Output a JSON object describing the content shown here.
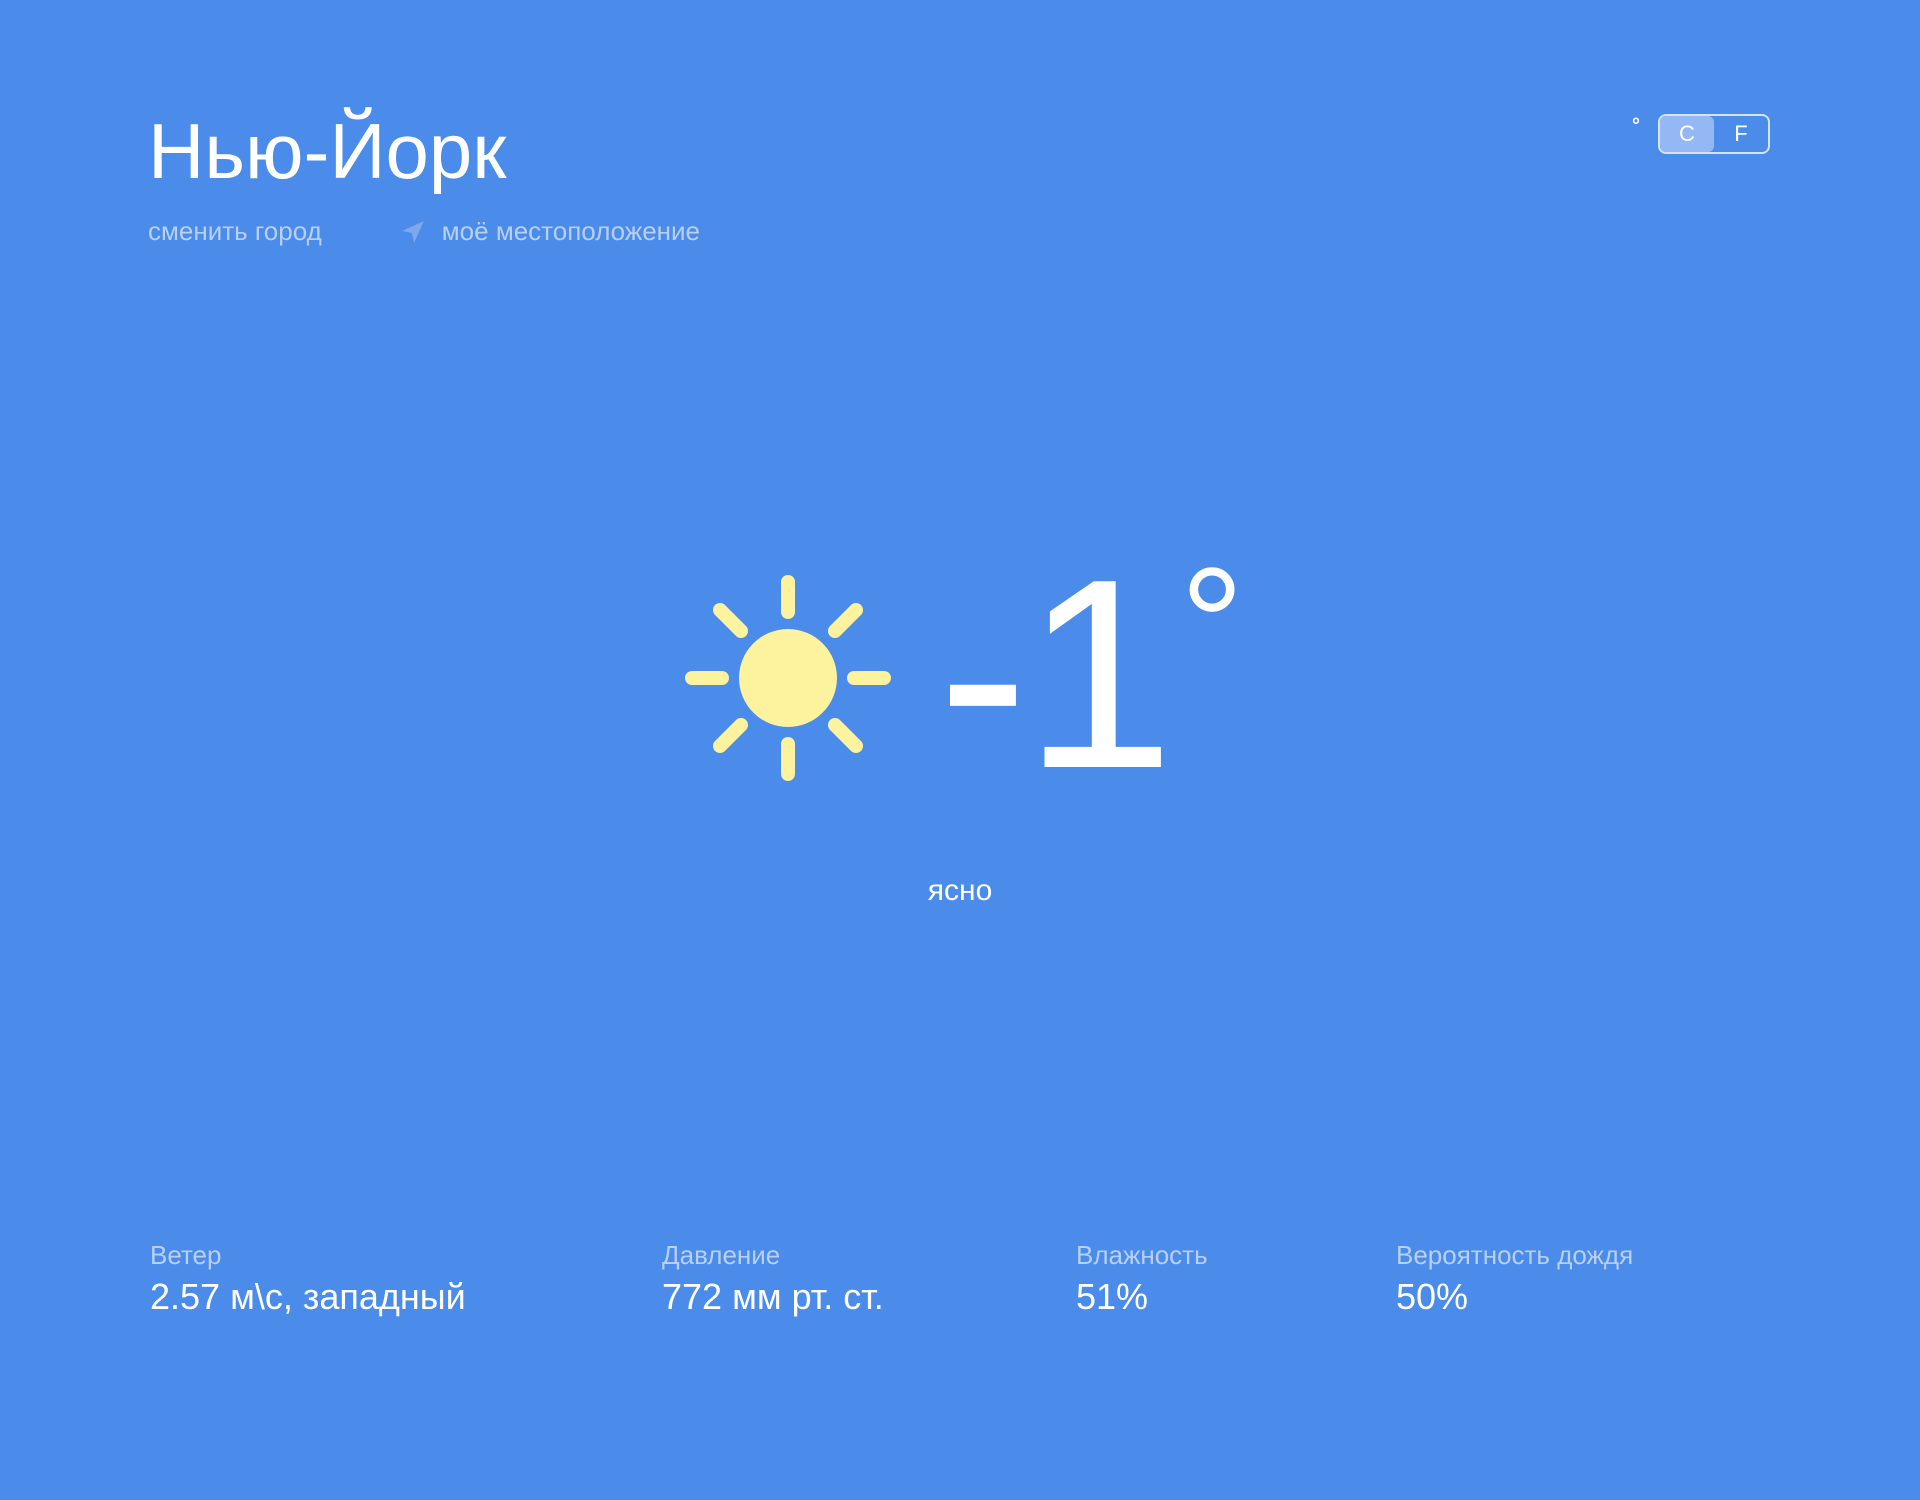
{
  "header": {
    "city": "Нью-Йорк",
    "change_city_label": "сменить город",
    "my_location_label": "моё местоположение",
    "location_icon": "location-arrow-icon"
  },
  "units": {
    "degree_symbol": "°",
    "options": [
      "C",
      "F"
    ],
    "selected": "C"
  },
  "current": {
    "icon": "sun-icon",
    "temperature": "-1",
    "degree": "°",
    "condition": "ясно"
  },
  "stats": {
    "wind": {
      "label": "Ветер",
      "value": "2.57 м\\с, западный"
    },
    "pressure": {
      "label": "Давление",
      "value": "772 мм рт. ст."
    },
    "humidity": {
      "label": "Влажность",
      "value": "51%"
    },
    "rain": {
      "label": "Вероятность дождя",
      "value": "50%"
    }
  },
  "colors": {
    "background": "#4b8bea",
    "text": "#ffffff",
    "muted_text": "#b8d0f5",
    "sun": "#fdf39f",
    "toggle_active": "#93b8f3"
  }
}
